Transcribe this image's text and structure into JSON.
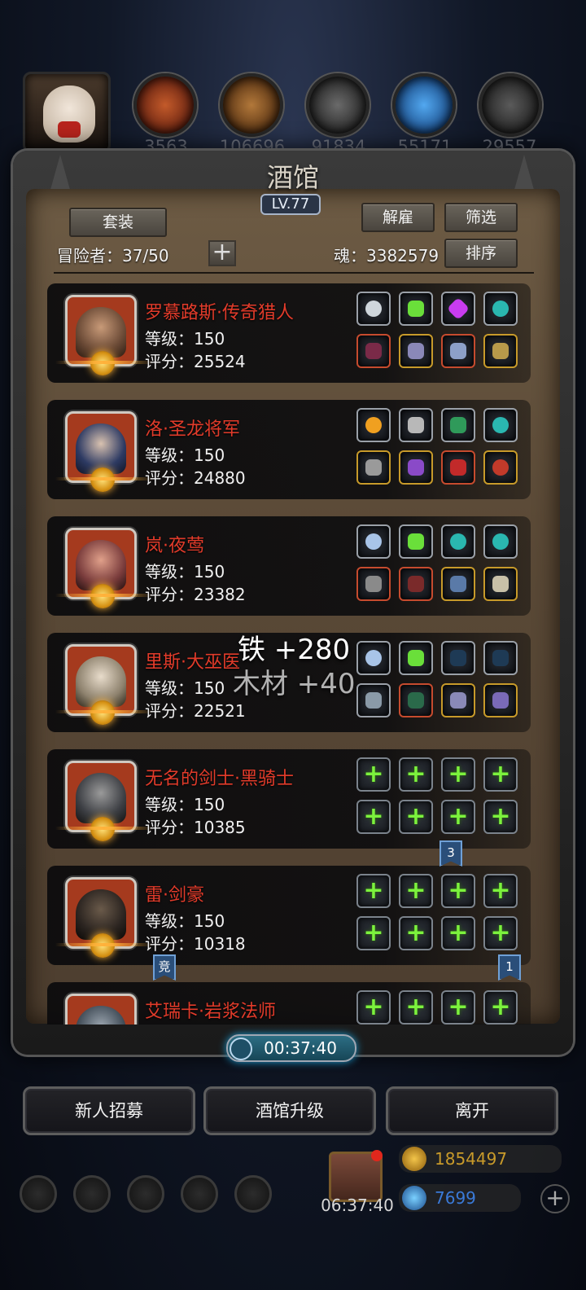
{
  "top_resources": {
    "portrait_icon": "bunny-avatar-icon",
    "items": [
      {
        "icon": "meat-icon",
        "value": "3563",
        "color": "#b44a22"
      },
      {
        "icon": "wood-icon",
        "value": "106696",
        "color": "#a86a36"
      },
      {
        "icon": "iron-icon",
        "value": "91834",
        "color": "#5d5d5d"
      },
      {
        "icon": "crystal-icon",
        "value": "55171",
        "color": "#2f78c4"
      },
      {
        "icon": "stone-icon",
        "value": "29557",
        "color": "#4d4d4d"
      }
    ]
  },
  "panel": {
    "title": "酒馆",
    "level": "LV.77",
    "set_button": "套装",
    "dismiss_button": "解雇",
    "filter_button": "筛选",
    "sort_button": "排序",
    "adventurers": "冒险者：37/50",
    "souls": "魂：3382579",
    "add_icon": "+"
  },
  "heroes": [
    {
      "name": "罗慕路斯·传奇猎人",
      "level": "等级：150",
      "score": "评分：25524",
      "face_color": "#6b4a36"
    },
    {
      "name": "洛·圣龙将军",
      "level": "等级：150",
      "score": "评分：24880",
      "face_color": "#2d3a63"
    },
    {
      "name": "岚·夜莺",
      "level": "等级：150",
      "score": "评分：23382",
      "face_color": "#7a3c3c"
    },
    {
      "name": "里斯·大巫医",
      "level": "等级：150",
      "score": "评分：22521",
      "face_color": "#8e826e"
    },
    {
      "name": "无名的剑士·黑骑士",
      "level": "等级：150",
      "score": "评分：10385",
      "face_color": "#3d3f44"
    },
    {
      "name": "雷·剑豪",
      "level": "等级：150",
      "score": "评分：10318",
      "face_color": "#2b2420"
    },
    {
      "name": "艾瑞卡·岩浆法师",
      "level": "",
      "score": "",
      "face_color": "#3f4a55"
    }
  ],
  "tags": {
    "tag_3": "3",
    "tag_jing": "竞",
    "tag_1": "1"
  },
  "floating_text": {
    "iron": "铁 +280",
    "wood": "木材 +40"
  },
  "timer": "00:37:40",
  "bottom_buttons": {
    "recruit": "新人招募",
    "upgrade": "酒馆升级",
    "leave": "离开"
  },
  "currency": {
    "gold": "1854497",
    "diamond": "7699"
  },
  "gift_timer": "06:37:40"
}
